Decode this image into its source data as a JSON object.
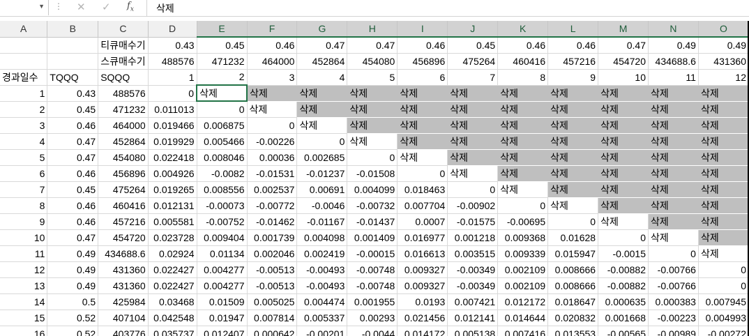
{
  "formula_bar": {
    "namebox": "",
    "content": "삭제"
  },
  "columns": [
    "A",
    "B",
    "C",
    "D",
    "E",
    "F",
    "G",
    "H",
    "I",
    "J",
    "K",
    "L",
    "M",
    "N",
    "O"
  ],
  "selected_column_start": 4,
  "header_rows": [
    [
      "",
      "",
      "티큐매수기",
      "0.43",
      "0.45",
      "0.46",
      "0.47",
      "0.47",
      "0.46",
      "0.45",
      "0.46",
      "0.46",
      "0.47",
      "0.49",
      "0.49"
    ],
    [
      "",
      "",
      "스큐매수기",
      "488576",
      "471232",
      "464000",
      "452864",
      "454080",
      "456896",
      "475264",
      "460416",
      "457216",
      "454720",
      "434688.6",
      "431360"
    ],
    [
      "경과일수",
      "TQQQ",
      "SQQQ",
      "1",
      "2",
      "3",
      "4",
      "5",
      "6",
      "7",
      "8",
      "9",
      "10",
      "11",
      "12"
    ]
  ],
  "del_label": "삭제",
  "data_rows": [
    [
      "1",
      "0.43",
      "488576",
      "0"
    ],
    [
      "2",
      "0.45",
      "471232",
      "0.011013",
      "0"
    ],
    [
      "3",
      "0.46",
      "464000",
      "0.019466",
      "0.006875",
      "0"
    ],
    [
      "4",
      "0.47",
      "452864",
      "0.019929",
      "0.005466",
      "-0.00226",
      "0"
    ],
    [
      "5",
      "0.47",
      "454080",
      "0.022418",
      "0.008046",
      "0.00036",
      "0.002685",
      "0"
    ],
    [
      "6",
      "0.46",
      "456896",
      "0.004926",
      "-0.0082",
      "-0.01531",
      "-0.01237",
      "-0.01508",
      "0"
    ],
    [
      "7",
      "0.45",
      "475264",
      "0.019265",
      "0.008556",
      "0.002537",
      "0.00691",
      "0.004099",
      "0.018463",
      "0"
    ],
    [
      "8",
      "0.46",
      "460416",
      "0.012131",
      "-0.00073",
      "-0.00772",
      "-0.0046",
      "-0.00732",
      "0.007704",
      "-0.00902",
      "0"
    ],
    [
      "9",
      "0.46",
      "457216",
      "0.005581",
      "-0.00752",
      "-0.01462",
      "-0.01167",
      "-0.01437",
      "0.0007",
      "-0.01575",
      "-0.00695",
      "0"
    ],
    [
      "10",
      "0.47",
      "454720",
      "0.023728",
      "0.009404",
      "0.001739",
      "0.004098",
      "0.001409",
      "0.016977",
      "0.001218",
      "0.009368",
      "0.01628",
      "0"
    ],
    [
      "11",
      "0.49",
      "434688.6",
      "0.02924",
      "0.01134",
      "0.002046",
      "0.002419",
      "-0.00015",
      "0.016613",
      "0.003515",
      "0.009339",
      "0.015947",
      "-0.0015",
      "0"
    ],
    [
      "12",
      "0.49",
      "431360",
      "0.022427",
      "0.004277",
      "-0.00513",
      "-0.00493",
      "-0.00748",
      "0.009327",
      "-0.00349",
      "0.002109",
      "0.008666",
      "-0.00882",
      "-0.00766",
      "0"
    ],
    [
      "13",
      "0.49",
      "431360",
      "0.022427",
      "0.004277",
      "-0.00513",
      "-0.00493",
      "-0.00748",
      "0.009327",
      "-0.00349",
      "0.002109",
      "0.008666",
      "-0.00882",
      "-0.00766",
      "0"
    ],
    [
      "14",
      "0.5",
      "425984",
      "0.03468",
      "0.01509",
      "0.005025",
      "0.004474",
      "0.001955",
      "0.0193",
      "0.007421",
      "0.012172",
      "0.018647",
      "0.000635",
      "0.000383",
      "0.007945"
    ],
    [
      "15",
      "0.52",
      "407104",
      "0.042548",
      "0.01947",
      "0.007814",
      "0.005337",
      "0.00293",
      "0.021456",
      "0.012141",
      "0.014644",
      "0.020832",
      "0.001668",
      "-0.00223",
      "0.004993"
    ],
    [
      "16",
      "0.52",
      "403776",
      "0.035737",
      "0.012407",
      "0.000642",
      "-0.00201",
      "-0.0044",
      "0.014172",
      "0.005138",
      "0.007416",
      "0.013553",
      "-0.00565",
      "-0.00989",
      "-0.00272"
    ]
  ],
  "icons": {
    "cancel": "close-icon",
    "enter": "check-icon",
    "fx": "function-icon"
  }
}
